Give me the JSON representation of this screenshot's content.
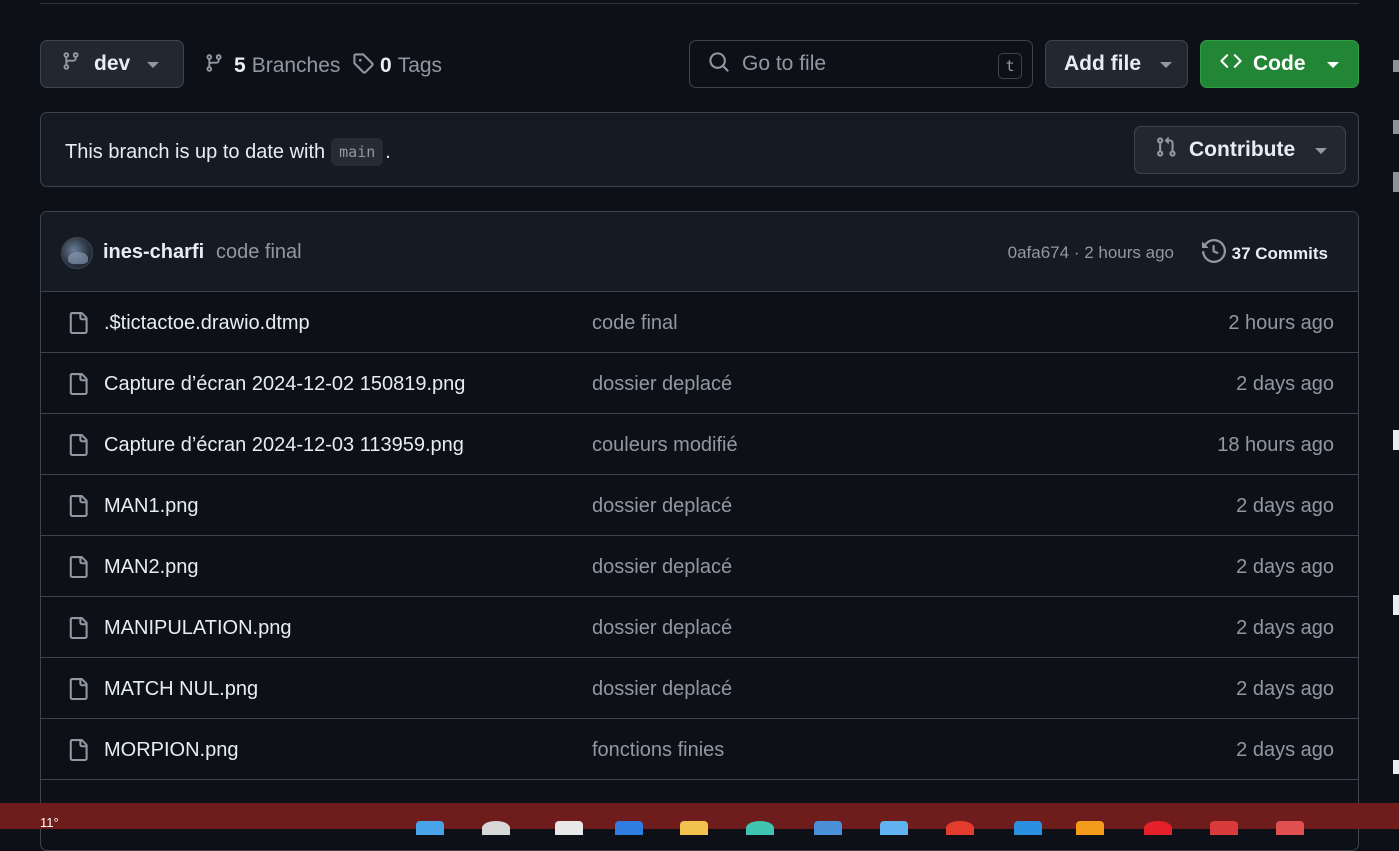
{
  "toolbar": {
    "branch_name": "dev",
    "branches_count": "5",
    "branches_label": "Branches",
    "tags_count": "0",
    "tags_label": "Tags",
    "search_placeholder": "Go to file",
    "search_shortcut": "t",
    "add_file_label": "Add file",
    "code_label": "Code"
  },
  "status": {
    "text": "This branch is up to date with",
    "base_branch": "main",
    "suffix": ".",
    "contribute_label": "Contribute"
  },
  "latest_commit": {
    "author": "ines-charfi",
    "message": "code final",
    "sha_time": "0afa674 · 2 hours ago",
    "commits_count": "37",
    "commits_label": "Commits"
  },
  "files": [
    {
      "name": ".$tictactoe.drawio.dtmp",
      "message": "code final",
      "date": "2 hours ago"
    },
    {
      "name": "Capture d’écran 2024-12-02 150819.png",
      "message": "dossier deplacé",
      "date": "2 days ago"
    },
    {
      "name": "Capture d’écran 2024-12-03 113959.png",
      "message": "couleurs modifié",
      "date": "18 hours ago"
    },
    {
      "name": "MAN1.png",
      "message": "dossier deplacé",
      "date": "2 days ago"
    },
    {
      "name": "MAN2.png",
      "message": "dossier deplacé",
      "date": "2 days ago"
    },
    {
      "name": "MANIPULATION.png",
      "message": "dossier deplacé",
      "date": "2 days ago"
    },
    {
      "name": "MATCH NUL.png",
      "message": "dossier deplacé",
      "date": "2 days ago"
    },
    {
      "name": "MORPION.png",
      "message": "fonctions finies",
      "date": "2 days ago"
    }
  ],
  "taskbar": {
    "temperature": "11°"
  },
  "colors": {
    "background": "#0d1117",
    "code_button": "#238636",
    "border": "#3d444d",
    "taskbar": "#6e1c1c"
  }
}
